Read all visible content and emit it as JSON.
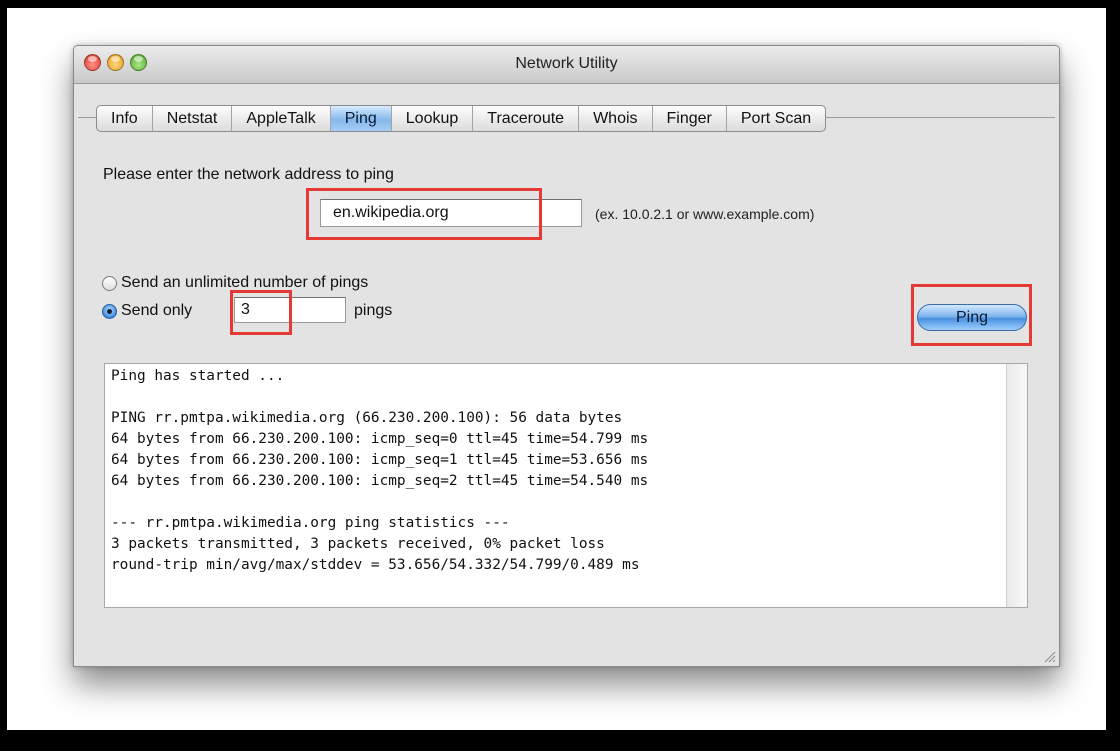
{
  "window": {
    "title": "Network Utility"
  },
  "tabs": [
    {
      "label": "Info"
    },
    {
      "label": "Netstat"
    },
    {
      "label": "AppleTalk"
    },
    {
      "label": "Ping",
      "active": true
    },
    {
      "label": "Lookup"
    },
    {
      "label": "Traceroute"
    },
    {
      "label": "Whois"
    },
    {
      "label": "Finger"
    },
    {
      "label": "Port Scan"
    }
  ],
  "ping": {
    "prompt": "Please enter the network address to ping",
    "address_value": "en.wikipedia.org",
    "address_hint": "(ex. 10.0.2.1 or www.example.com)",
    "option_unlimited": "Send an unlimited number of pings",
    "option_limited_prefix": "Send only",
    "count_value": "3",
    "option_limited_suffix": "pings",
    "selected_option": "limited",
    "button_label": "Ping"
  },
  "output": {
    "lines": [
      "Ping has started ...",
      "",
      "PING rr.pmtpa.wikimedia.org (66.230.200.100): 56 data bytes",
      "64 bytes from 66.230.200.100: icmp_seq=0 ttl=45 time=54.799 ms",
      "64 bytes from 66.230.200.100: icmp_seq=1 ttl=45 time=53.656 ms",
      "64 bytes from 66.230.200.100: icmp_seq=2 ttl=45 time=54.540 ms",
      "",
      "--- rr.pmtpa.wikimedia.org ping statistics ---",
      "3 packets transmitted, 3 packets received, 0% packet loss",
      "round-trip min/avg/max/stddev = 53.656/54.332/54.799/0.489 ms"
    ]
  },
  "colors": {
    "annotation": "#e53935",
    "tab_active": "#84b8ec",
    "button_blue": "#4b91e0"
  }
}
